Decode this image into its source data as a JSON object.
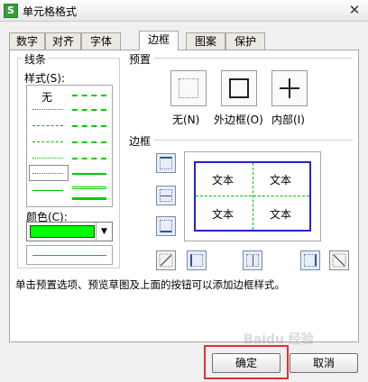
{
  "window": {
    "title": "单元格格式",
    "app_icon_glyph": "S",
    "close_glyph": "✕"
  },
  "tabs": [
    {
      "label": "数字"
    },
    {
      "label": "对齐"
    },
    {
      "label": "字体"
    },
    {
      "label": "边框",
      "active": true
    },
    {
      "label": "图案"
    },
    {
      "label": "保护"
    }
  ],
  "line_group": {
    "title": "线条",
    "style_label": "样式(S):",
    "none_label": "无",
    "color_label": "颜色(C):",
    "selected_color": "#00ff00"
  },
  "presets": {
    "title": "预置",
    "items": [
      {
        "label": "无(N)"
      },
      {
        "label": "外边框(O)"
      },
      {
        "label": "内部(I)"
      }
    ]
  },
  "border": {
    "title": "边框",
    "preview_cells": [
      "文本",
      "文本",
      "文本",
      "文本"
    ],
    "preview_border_color": "#2323c8"
  },
  "note": "单击预置选项、预览草图及上面的按钮可以添加边框样式。",
  "buttons": {
    "ok": "确定",
    "cancel": "取消"
  },
  "highlight_color": "#e03030",
  "watermark": "Baidu 经验"
}
